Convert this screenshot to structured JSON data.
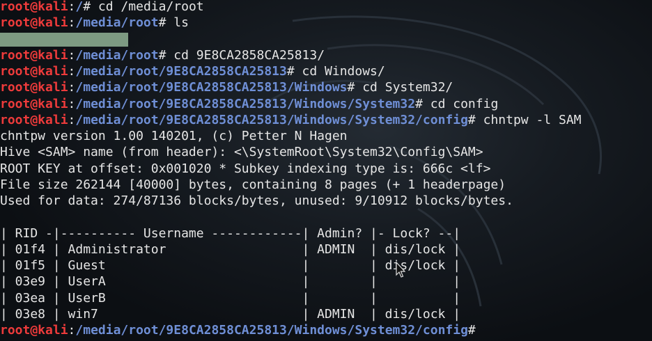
{
  "prompt": {
    "user_host": "root@kali",
    "sep": ":"
  },
  "lines": [
    {
      "type": "prompt",
      "path": "/",
      "sym": "# ",
      "cmd": "cd /media/root"
    },
    {
      "type": "prompt",
      "path": "/media/root",
      "sym": "# ",
      "cmd": "ls"
    },
    {
      "type": "redacted"
    },
    {
      "type": "prompt",
      "path": "/media/root",
      "sym": "# ",
      "cmd": "cd 9E8CA2858CA25813/"
    },
    {
      "type": "prompt",
      "path": "/media/root/9E8CA2858CA25813",
      "sym": "# ",
      "cmd": "cd Windows/"
    },
    {
      "type": "prompt",
      "path": "/media/root/9E8CA2858CA25813/Windows",
      "sym": "# ",
      "cmd": "cd System32/"
    },
    {
      "type": "prompt",
      "path": "/media/root/9E8CA2858CA25813/Windows/System32",
      "sym": "# ",
      "cmd": "cd config"
    },
    {
      "type": "prompt",
      "path": "/media/root/9E8CA2858CA25813/Windows/System32/config",
      "sym": "# ",
      "cmd": "chntpw -l SAM"
    },
    {
      "type": "output",
      "text": "chntpw version 1.00 140201, (c) Petter N Hagen"
    },
    {
      "type": "output",
      "text": "Hive <SAM> name (from header): <\\SystemRoot\\System32\\Config\\SAM>"
    },
    {
      "type": "output",
      "text": "ROOT KEY at offset: 0x001020 * Subkey indexing type is: 666c <lf>"
    },
    {
      "type": "output",
      "text": "File size 262144 [40000] bytes, containing 8 pages (+ 1 headerpage)"
    },
    {
      "type": "output",
      "text": "Used for data: 274/87136 blocks/bytes, unused: 9/10912 blocks/bytes."
    },
    {
      "type": "output",
      "text": ""
    },
    {
      "type": "output",
      "text": "| RID -|---------- Username ------------| Admin? |- Lock? --|"
    },
    {
      "type": "output",
      "text": "| 01f4 | Administrator                  | ADMIN  | dis/lock |"
    },
    {
      "type": "output",
      "text": "| 01f5 | Guest                          |        | dis/lock |"
    },
    {
      "type": "output",
      "text": "| 03e9 | UserA                          |        |          |"
    },
    {
      "type": "output",
      "text": "| 03ea | UserB                          |        |          |"
    },
    {
      "type": "output",
      "text": "| 03e8 | win7                           | ADMIN  | dis/lock |"
    },
    {
      "type": "prompt",
      "path": "/media/root/9E8CA2858CA25813/Windows/System32/config",
      "sym": "#",
      "cmd": ""
    }
  ]
}
